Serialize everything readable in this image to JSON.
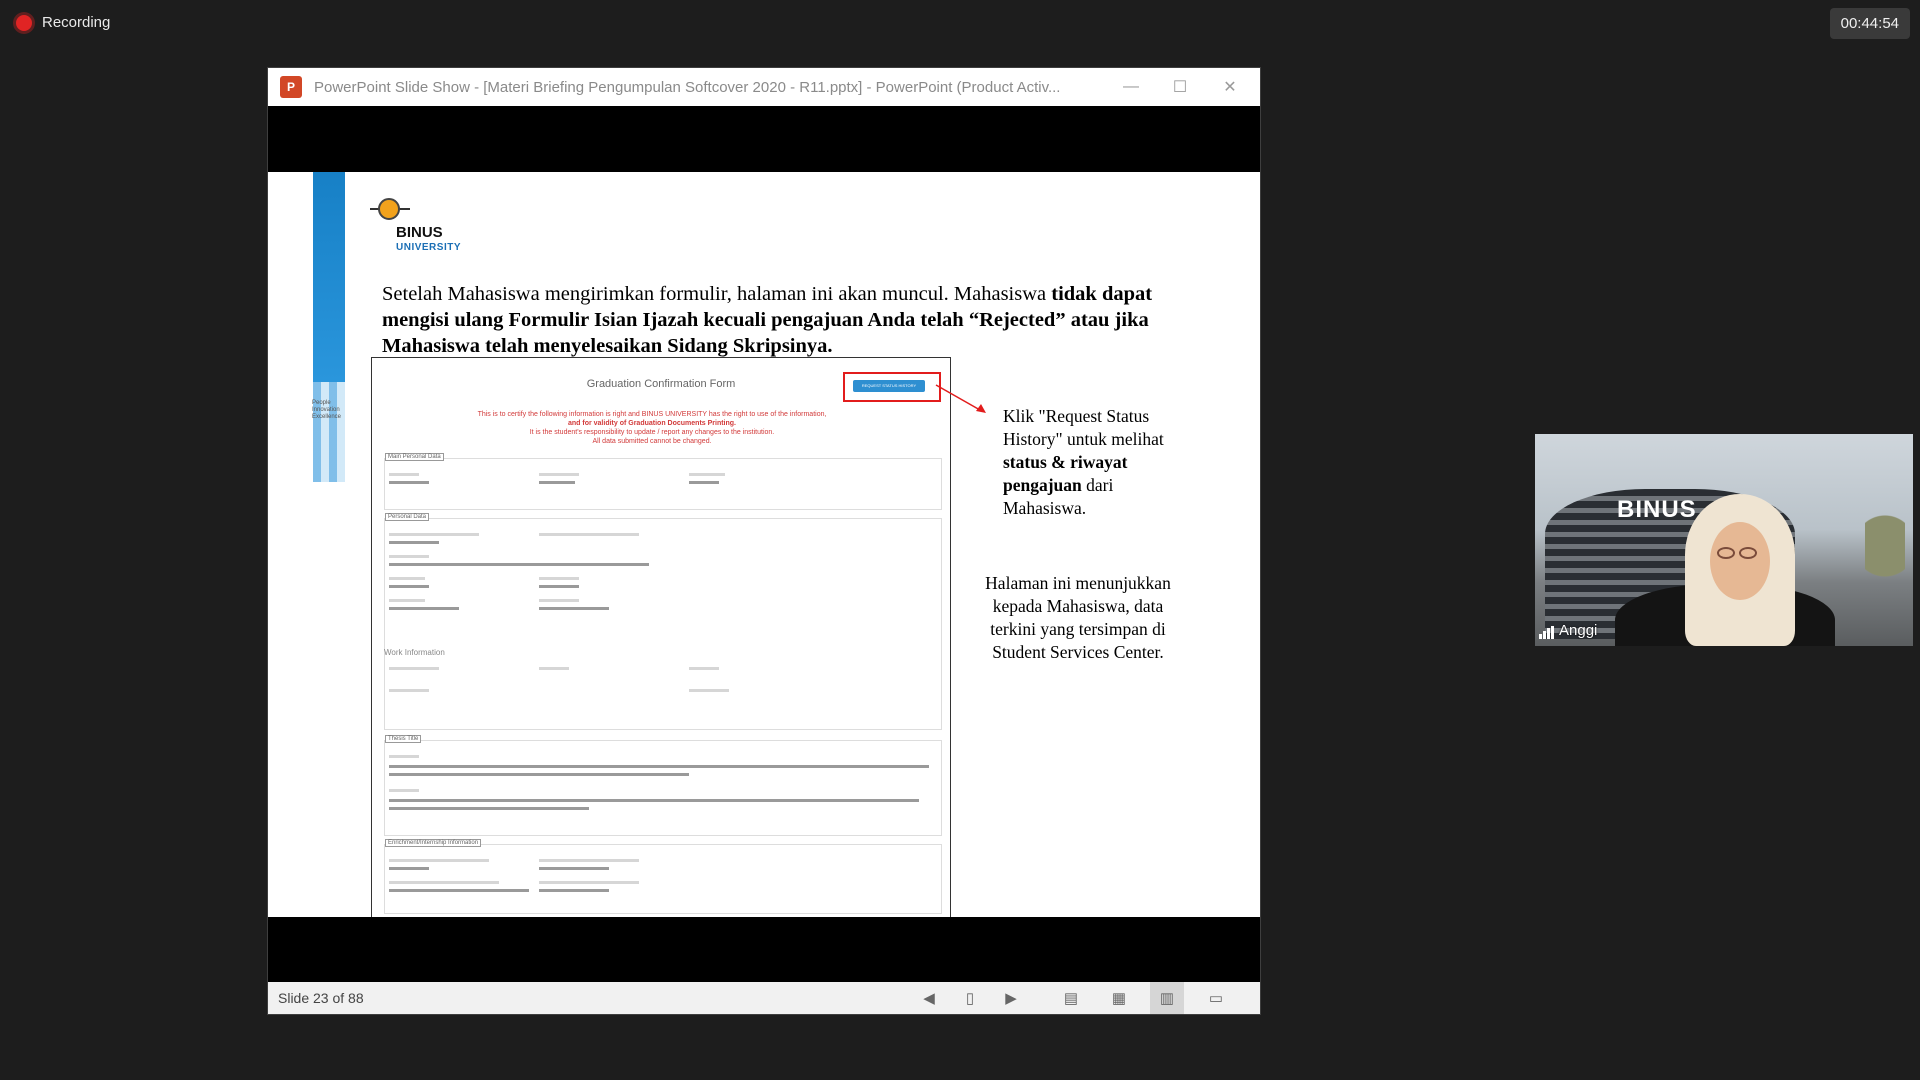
{
  "recording": {
    "label": "Recording"
  },
  "timer": "00:44:54",
  "window": {
    "title": "PowerPoint Slide Show - [Materi Briefing Pengumpulan Softcover 2020 - R11.pptx] - PowerPoint (Product Activ...",
    "app_icon": "P",
    "controls": {
      "minimize": "—",
      "maximize": "☐",
      "close": "✕"
    }
  },
  "slide": {
    "logo": {
      "name": "BINUS",
      "sub": "UNIVERSITY"
    },
    "tagline": [
      "People",
      "Innovation",
      "Excellence"
    ],
    "headline": {
      "part1": "Setelah Mahasiswa mengirimkan formulir, halaman ini akan muncul. Mahasiswa ",
      "bold": "tidak dapat mengisi ulang Formulir Isian Ijazah kecuali pengajuan Anda telah “Rejected” atau jika Mahasiswa telah menyelesaikan Sidang Skripsinya."
    },
    "form": {
      "title": "Graduation Confirmation Form",
      "request_button": "REQUEST STATUS HISTORY",
      "notice": [
        "This is to certify the following information is right and BINUS UNIVERSITY has the right to use of the information,",
        "and for validity of Graduation Documents Printing.",
        "It is the student's responsibility to update / report any changes to the institution.",
        "All data submitted cannot be changed."
      ],
      "sections": [
        "Main Personal Data",
        "Personal Data",
        "Thesis Title",
        "Enrichment/Internship Information"
      ],
      "work_label": "Work Information"
    },
    "side_note_1": {
      "plain1": "Klik \"Request Status History\" untuk melihat ",
      "bold": "status & riwayat pengajuan",
      "plain2": " dari Mahasiswa."
    },
    "side_note_2": "Halaman ini menunjukkan kepada Mahasiswa, data terkini yang tersimpan di Student Services Center."
  },
  "statusbar": {
    "slide_count": "Slide 23 of 88",
    "icons": [
      "previous-icon",
      "notes-icon",
      "next-icon",
      "normal-view-icon",
      "slide-sorter-icon",
      "reading-view-icon",
      "slideshow-icon"
    ]
  },
  "participant": {
    "name": "Anggi",
    "background_sign": "BINUS"
  },
  "colors": {
    "recording_red": "#e02424",
    "binus_blue": "#1780c6",
    "highlight_red": "#e21c1c"
  }
}
